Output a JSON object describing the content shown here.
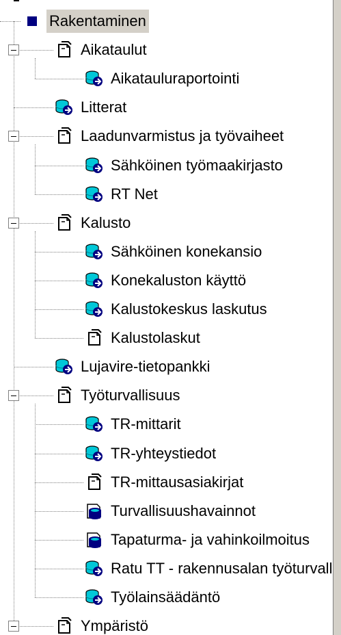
{
  "tree": {
    "items": [
      {
        "label": "Rakentaminen",
        "level": 0,
        "icon": "root-square-icon",
        "expander": false,
        "selected": true
      },
      {
        "label": "Aikataulut",
        "level": 1,
        "icon": "document-icon",
        "expander": true
      },
      {
        "label": "Aikatauluraportointi",
        "level": 2,
        "icon": "database-icon"
      },
      {
        "label": "Litterat",
        "level": 1,
        "icon": "database-icon"
      },
      {
        "label": "Laadunvarmistus ja työvaiheet",
        "level": 1,
        "icon": "document-icon",
        "expander": true
      },
      {
        "label": "Sähköinen työmaakirjasto",
        "level": 2,
        "icon": "database-icon"
      },
      {
        "label": "RT Net",
        "level": 2,
        "icon": "database-icon"
      },
      {
        "label": "Kalusto",
        "level": 1,
        "icon": "document-icon",
        "expander": true
      },
      {
        "label": "Sähköinen konekansio",
        "level": 2,
        "icon": "database-icon"
      },
      {
        "label": "Konekaluston käyttö",
        "level": 2,
        "icon": "database-icon"
      },
      {
        "label": "Kalustokeskus laskutus",
        "level": 2,
        "icon": "database-icon"
      },
      {
        "label": "Kalustolaskut",
        "level": 2,
        "icon": "document-icon"
      },
      {
        "label": "Lujavire-tietopankki",
        "level": 1,
        "icon": "database-icon"
      },
      {
        "label": "Työturvallisuus",
        "level": 1,
        "icon": "document-icon",
        "expander": true
      },
      {
        "label": "TR-mittarit",
        "level": 2,
        "icon": "database-icon"
      },
      {
        "label": "TR-yhteystiedot",
        "level": 2,
        "icon": "database-icon"
      },
      {
        "label": "TR-mittausasiakirjat",
        "level": 2,
        "icon": "document-icon"
      },
      {
        "label": "Turvallisuushavainnot",
        "level": 2,
        "icon": "form-database-icon"
      },
      {
        "label": "Tapaturma- ja vahinkoilmoitus",
        "level": 2,
        "icon": "form-database-icon"
      },
      {
        "label": "Ratu TT - rakennusalan työturvallisuus",
        "level": 2,
        "icon": "database-icon"
      },
      {
        "label": "Työlainsäädäntö",
        "level": 2,
        "icon": "database-icon"
      },
      {
        "label": "Ympäristö",
        "level": 1,
        "icon": "document-icon",
        "expander": true
      }
    ]
  },
  "colors": {
    "selection": "#d4d0c8",
    "root_square": "#000080",
    "db_cyan": "#00c8d8",
    "db_navy": "#000080",
    "tree_lines": "#808080"
  }
}
